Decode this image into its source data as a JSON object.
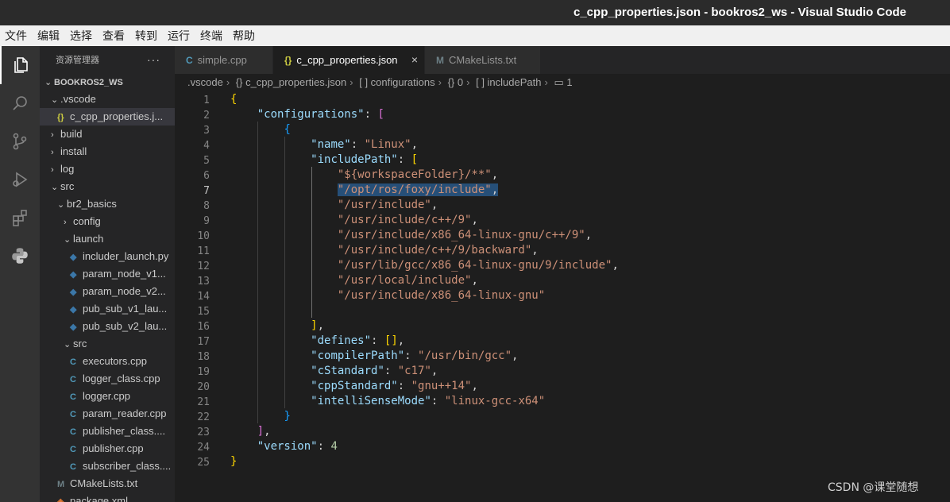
{
  "window": {
    "title": "c_cpp_properties.json - bookros2_ws - Visual Studio Code"
  },
  "menu": [
    "文件",
    "编辑",
    "选择",
    "查看",
    "转到",
    "运行",
    "终端",
    "帮助"
  ],
  "activity_bar": [
    {
      "name": "files-icon",
      "active": true
    },
    {
      "name": "search-icon",
      "active": false
    },
    {
      "name": "source-control-icon",
      "active": false
    },
    {
      "name": "run-debug-icon",
      "active": false
    },
    {
      "name": "extensions-icon",
      "active": false
    },
    {
      "name": "python-icon",
      "active": false
    }
  ],
  "explorer": {
    "title": "资源管理器",
    "more": "···",
    "items": [
      {
        "label": "BOOKROS2_WS",
        "type": "root",
        "expanded": true
      },
      {
        "label": ".vscode",
        "type": "folder",
        "expanded": true
      },
      {
        "label": "c_cpp_properties.j...",
        "type": "json",
        "selected": true
      },
      {
        "label": "build",
        "type": "folder",
        "expanded": false
      },
      {
        "label": "install",
        "type": "folder",
        "expanded": false
      },
      {
        "label": "log",
        "type": "folder",
        "expanded": false
      },
      {
        "label": "src",
        "type": "folder",
        "expanded": true
      },
      {
        "label": "br2_basics",
        "type": "folder",
        "expanded": true
      },
      {
        "label": "config",
        "type": "folder",
        "expanded": false
      },
      {
        "label": "launch",
        "type": "folder",
        "expanded": true
      },
      {
        "label": "includer_launch.py",
        "type": "py"
      },
      {
        "label": "param_node_v1...",
        "type": "py"
      },
      {
        "label": "param_node_v2...",
        "type": "py"
      },
      {
        "label": "pub_sub_v1_lau...",
        "type": "py"
      },
      {
        "label": "pub_sub_v2_lau...",
        "type": "py"
      },
      {
        "label": "src",
        "type": "folder",
        "expanded": true
      },
      {
        "label": "executors.cpp",
        "type": "cpp"
      },
      {
        "label": "logger_class.cpp",
        "type": "cpp"
      },
      {
        "label": "logger.cpp",
        "type": "cpp"
      },
      {
        "label": "param_reader.cpp",
        "type": "cpp"
      },
      {
        "label": "publisher_class....",
        "type": "cpp"
      },
      {
        "label": "publisher.cpp",
        "type": "cpp"
      },
      {
        "label": "subscriber_class....",
        "type": "cpp"
      },
      {
        "label": "CMakeLists.txt",
        "type": "cmake"
      },
      {
        "label": "package.xml",
        "type": "xml"
      }
    ]
  },
  "tabs": [
    {
      "label": "simple.cpp",
      "icon": "C",
      "active": false
    },
    {
      "label": "c_cpp_properties.json",
      "icon": "{}",
      "active": true,
      "close": "×"
    },
    {
      "label": "CMakeLists.txt",
      "icon": "M",
      "active": false
    }
  ],
  "breadcrumb": [
    ".vscode",
    "{} c_cpp_properties.json",
    "[ ] configurations",
    "{} 0",
    "[ ] includePath",
    "▭ 1"
  ],
  "editor": {
    "current_line": 7,
    "lines": [
      "{",
      "    \"configurations\": [",
      "        {",
      "            \"name\": \"Linux\",",
      "            \"includePath\": [",
      "                \"${workspaceFolder}/**\",",
      "                \"/opt/ros/foxy/include\",",
      "                \"/usr/include\",",
      "                \"/usr/include/c++/9\",",
      "                \"/usr/include/x86_64-linux-gnu/c++/9\",",
      "                \"/usr/include/c++/9/backward\",",
      "                \"/usr/lib/gcc/x86_64-linux-gnu/9/include\",",
      "                \"/usr/local/include\",",
      "                \"/usr/include/x86_64-linux-gnu\"",
      "",
      "            ],",
      "            \"defines\": [],",
      "            \"compilerPath\": \"/usr/bin/gcc\",",
      "            \"cStandard\": \"c17\",",
      "            \"cppStandard\": \"gnu++14\",",
      "            \"intelliSenseMode\": \"linux-gcc-x64\"",
      "        }",
      "    ],",
      "    \"version\": 4",
      "}"
    ]
  },
  "watermark": "CSDN @课堂随想"
}
